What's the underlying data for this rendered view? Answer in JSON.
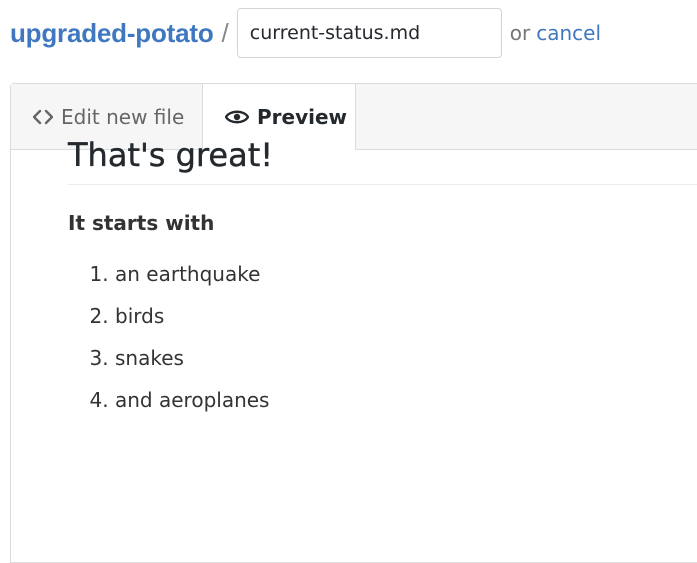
{
  "header": {
    "repo_name": "upgraded-potato",
    "separator": "/",
    "filename_value": "current-status.md",
    "or_text": "or",
    "cancel_label": "cancel"
  },
  "tabs": [
    {
      "label": "Edit new file",
      "icon": "code-icon",
      "active": false
    },
    {
      "label": "Preview",
      "icon": "eye-icon",
      "active": true
    }
  ],
  "preview": {
    "heading": "That's great!",
    "lead": "It starts with",
    "items": [
      "an earthquake",
      "birds",
      "snakes",
      "and aeroplanes"
    ]
  },
  "colors": {
    "link": "#4078c0",
    "text": "#24292e",
    "tab_bg": "#f6f6f6",
    "border": "#dcdcdc"
  }
}
